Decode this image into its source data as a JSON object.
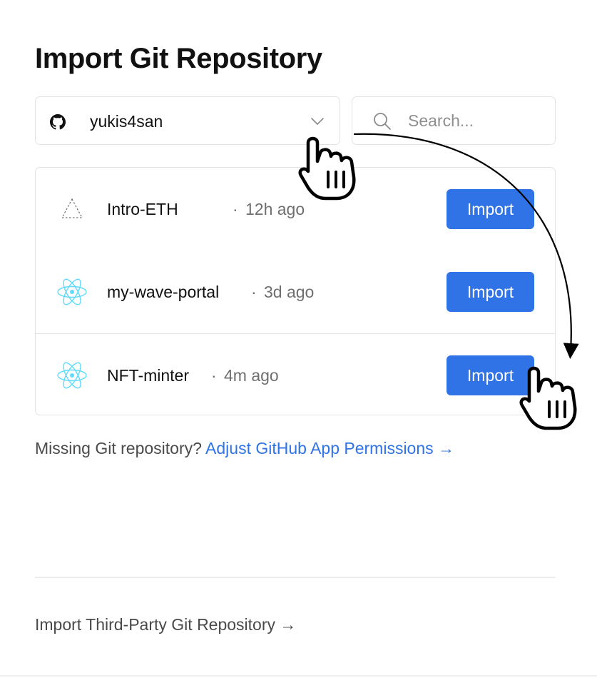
{
  "page": {
    "title": "Import Git Repository"
  },
  "account": {
    "name": "yukis4san",
    "icon": "github-icon"
  },
  "search": {
    "placeholder": "Search..."
  },
  "repositories": [
    {
      "name": "Intro-ETH",
      "separator": "·",
      "updated": "12h ago",
      "icon": "triangle-dashed-icon",
      "button_label": "Import"
    },
    {
      "name": "my-wave-portal",
      "separator": "·",
      "updated": "3d ago",
      "icon": "react-atom-icon",
      "button_label": "Import"
    },
    {
      "name": "NFT-minter",
      "separator": "·",
      "updated": "4m ago",
      "icon": "react-atom-icon",
      "button_label": "Import"
    }
  ],
  "missing": {
    "text": "Missing Git repository?",
    "link_label": "Adjust GitHub App Permissions →"
  },
  "third_party": {
    "link_label": "Import Third-Party Git Repository →"
  },
  "colors": {
    "accent": "#2f73e6",
    "react": "#61dafb",
    "border": "#e3e3e3"
  },
  "annotation": {
    "cursor_icon": "hand-pointer-icon",
    "arrow_icon": "curved-arrow-icon"
  }
}
